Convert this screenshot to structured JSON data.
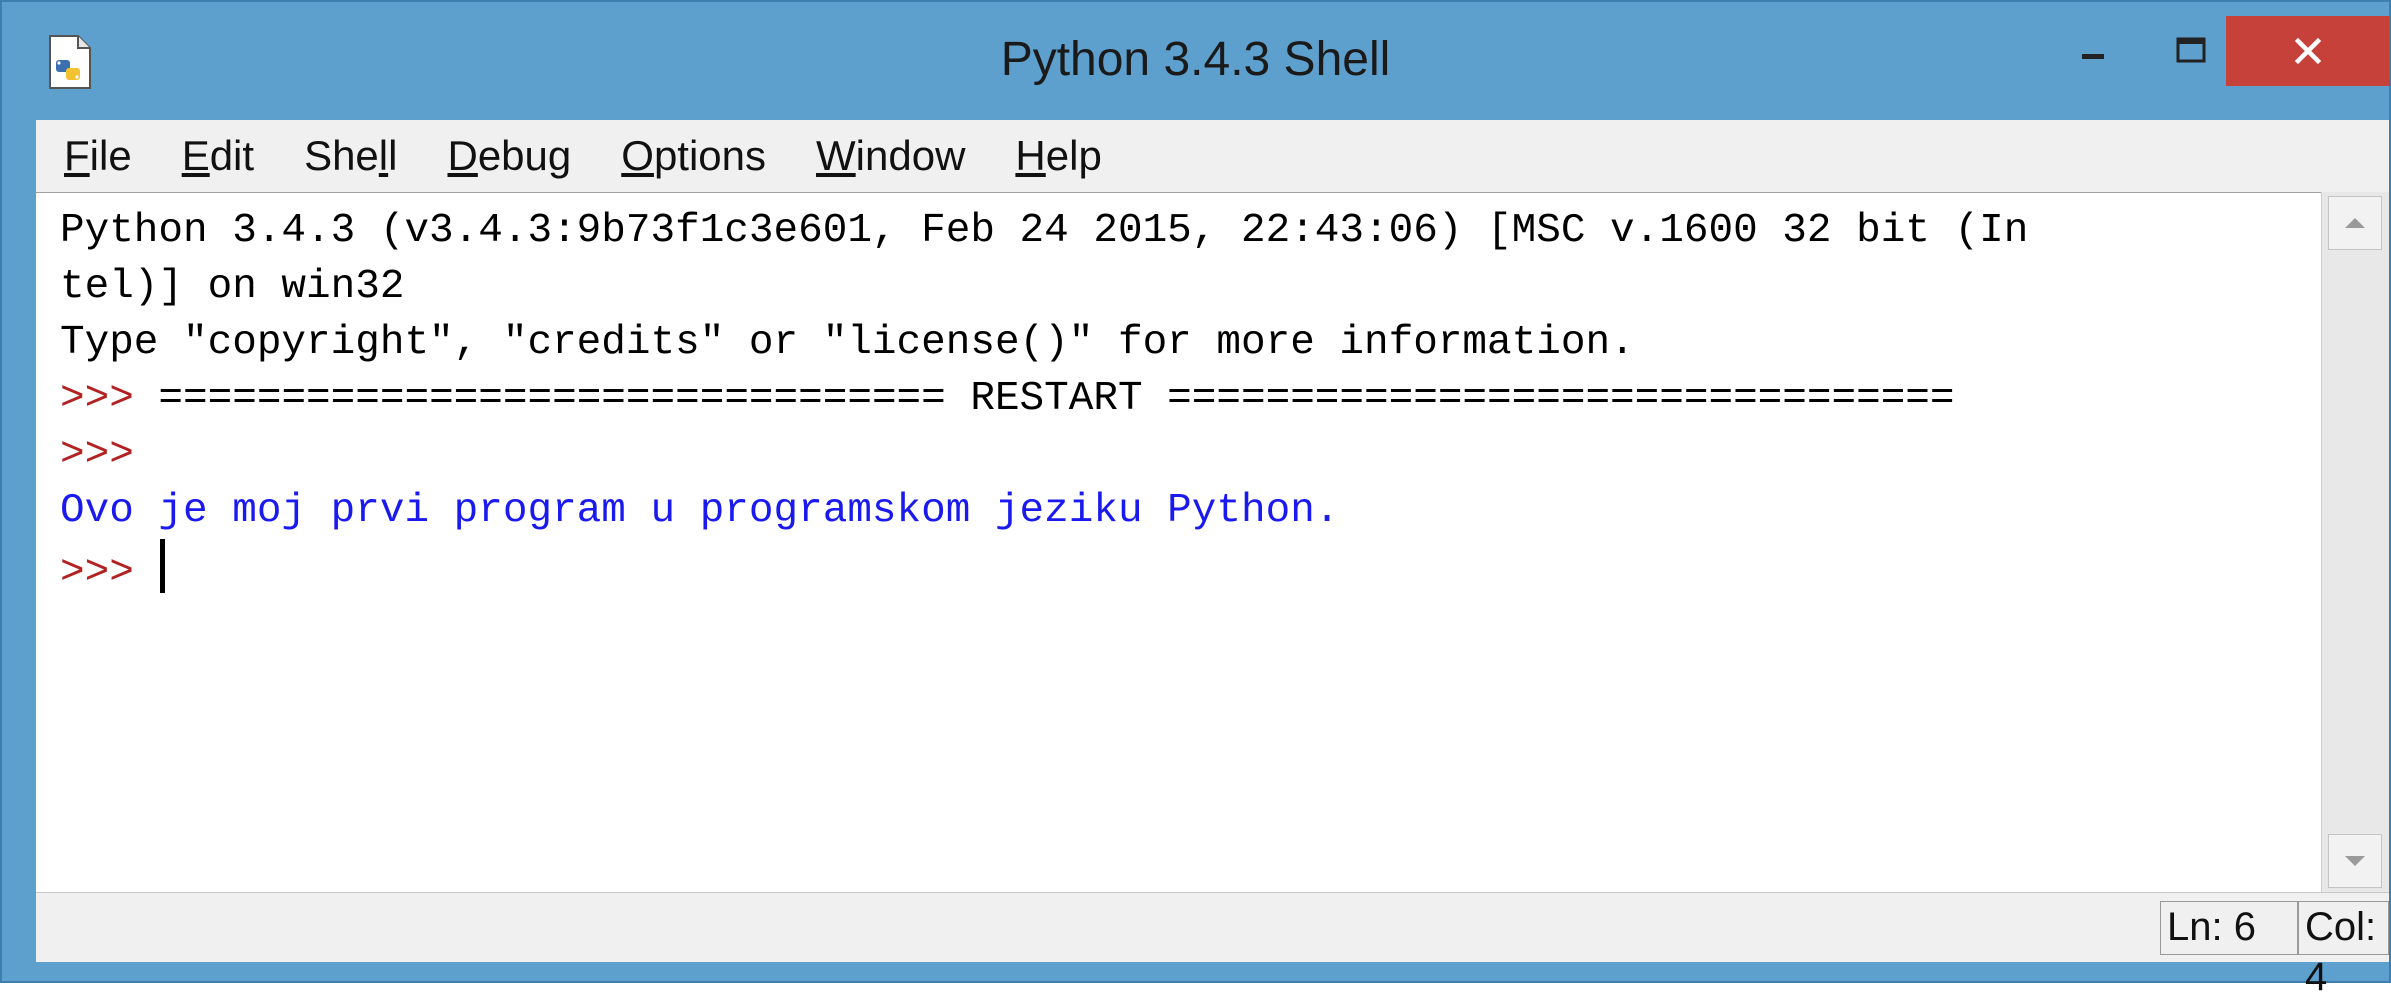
{
  "window": {
    "title": "Python 3.4.3 Shell",
    "icon": "python-file-icon",
    "controls": [
      "minimize-icon",
      "maximize-icon",
      "close-icon"
    ]
  },
  "menu": {
    "items": [
      {
        "label": "File",
        "accel": "F"
      },
      {
        "label": "Edit",
        "accel": "E"
      },
      {
        "label": "Shell",
        "accel": "l"
      },
      {
        "label": "Debug",
        "accel": "D"
      },
      {
        "label": "Options",
        "accel": "O"
      },
      {
        "label": "Window",
        "accel": "W"
      },
      {
        "label": "Help",
        "accel": "H"
      }
    ]
  },
  "shell": {
    "lines": [
      {
        "prompt": "",
        "text": "Python 3.4.3 (v3.4.3:9b73f1c3e601, Feb 24 2015, 22:43:06) [MSC v.1600 32 bit (In",
        "kind": "plain"
      },
      {
        "prompt": "",
        "text": "tel)] on win32",
        "kind": "plain"
      },
      {
        "prompt": "",
        "text": "Type \"copyright\", \"credits\" or \"license()\" for more information.",
        "kind": "plain"
      },
      {
        "prompt": ">>> ",
        "text": "================================ RESTART ================================",
        "kind": "plain"
      },
      {
        "prompt": ">>> ",
        "text": "",
        "kind": "plain"
      },
      {
        "prompt": "",
        "text": "Ovo je moj prvi program u programskom jeziku Python.",
        "kind": "output"
      },
      {
        "prompt": ">>> ",
        "text": "",
        "kind": "cursor"
      }
    ]
  },
  "status": {
    "ln": "Ln: 6",
    "col": "Col: 4"
  },
  "colors": {
    "prompt": "#b22222",
    "output": "#1a1aee",
    "titlebar": "#5d9fcd",
    "close_button": "#c7413b"
  }
}
